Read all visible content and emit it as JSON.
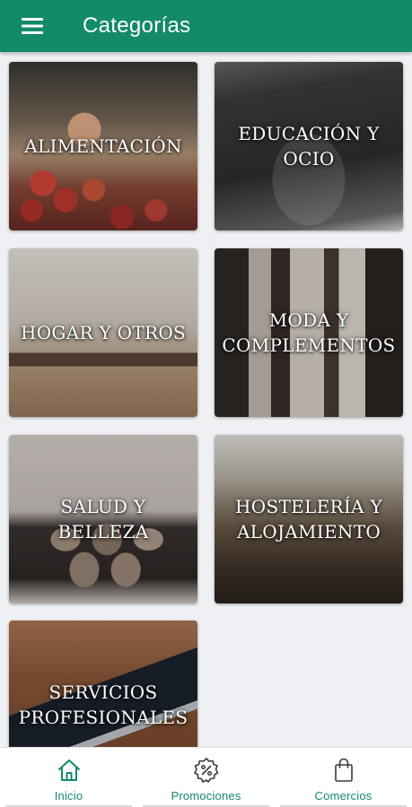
{
  "app_bar": {
    "title": "Categorías",
    "menu_icon": "hamburger-menu-icon"
  },
  "categories": [
    {
      "label": "ALIMENTACIÓN"
    },
    {
      "label": "EDUCACIÓN Y\nOCIO"
    },
    {
      "label": "HOGAR Y OTROS"
    },
    {
      "label": "MODA Y\nCOMPLEMENTOS"
    },
    {
      "label": "SALUD Y BELLEZA"
    },
    {
      "label": "HOSTELERÍA Y\nALOJAMIENTO"
    },
    {
      "label": "SERVICIOS\nPROFESIONALES"
    }
  ],
  "bottom_nav": {
    "items": [
      {
        "label": "Inicio",
        "icon": "home-icon"
      },
      {
        "label": "Promociones",
        "icon": "percent-badge-icon"
      },
      {
        "label": "Comercios",
        "icon": "shopping-bag-icon"
      }
    ]
  },
  "colors": {
    "primary": "#138a68",
    "background": "#eef0f3",
    "nav_background": "#ffffff"
  }
}
